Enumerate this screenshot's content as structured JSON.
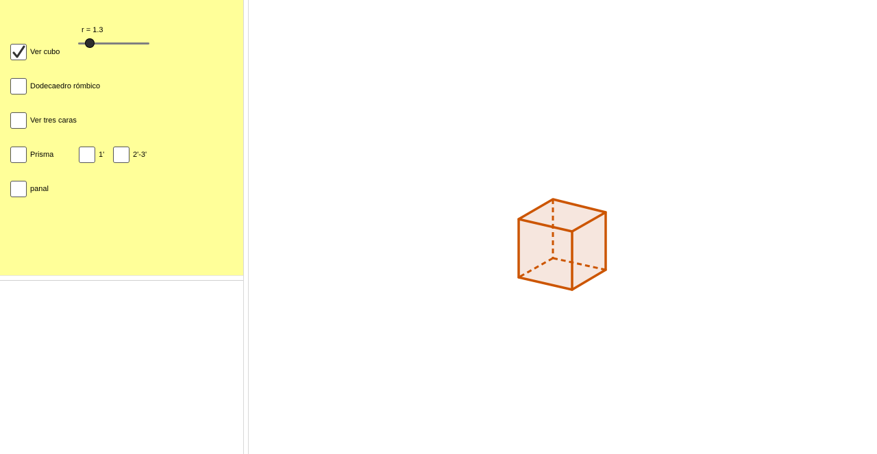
{
  "slider": {
    "label": "r = 1.3",
    "value": 1.3,
    "fill_fraction": 0.16
  },
  "checkboxes": {
    "ver_cubo": {
      "label": "Ver cubo",
      "checked": true
    },
    "dodecaedro": {
      "label": "Dodecaedro rómbico",
      "checked": false
    },
    "tres_caras": {
      "label": "Ver tres caras",
      "checked": false
    },
    "prisma": {
      "label": "Prisma",
      "checked": false
    },
    "one_prime": {
      "label": "1'",
      "checked": false
    },
    "two_three_prime": {
      "label": "2'-3'",
      "checked": false
    },
    "panal": {
      "label": "panal",
      "checked": false
    }
  },
  "colors": {
    "panel_background": "#ffff99",
    "cube_edge": "#cc5500",
    "cube_face": "#f4e2d8"
  }
}
